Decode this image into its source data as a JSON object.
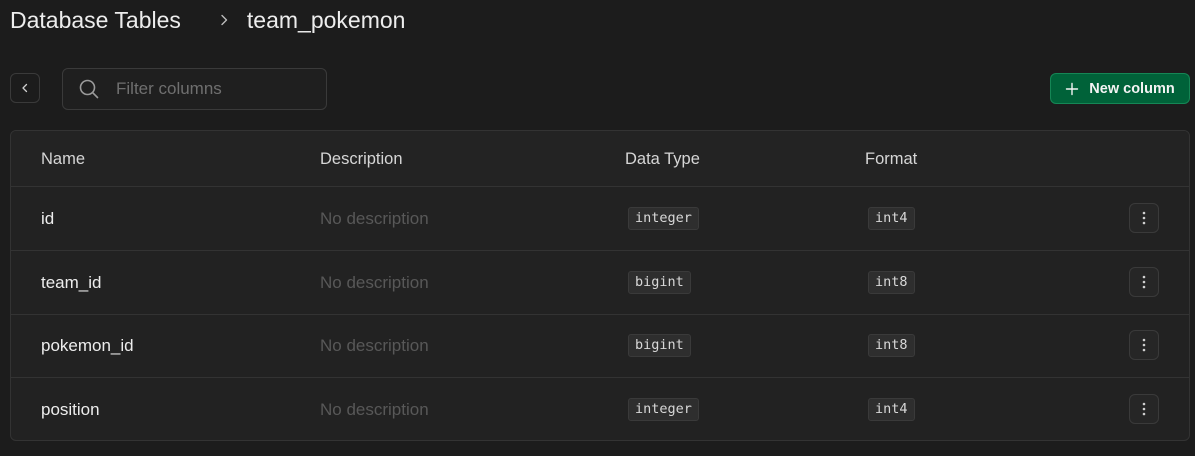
{
  "breadcrumb": {
    "root": "Database Tables",
    "current": "team_pokemon",
    "separator_icon": "chevron-right-icon"
  },
  "toolbar": {
    "back_icon": "chevron-left-icon",
    "filter": {
      "placeholder": "Filter columns",
      "value": "",
      "icon": "search-icon"
    },
    "new_column_label": "New column",
    "new_column_icon": "plus-icon"
  },
  "table": {
    "headers": {
      "name": "Name",
      "description": "Description",
      "data_type": "Data Type",
      "format": "Format"
    },
    "rows": [
      {
        "name": "id",
        "description": "No description",
        "data_type": "integer",
        "format": "int4"
      },
      {
        "name": "team_id",
        "description": "No description",
        "data_type": "bigint",
        "format": "int8"
      },
      {
        "name": "pokemon_id",
        "description": "No description",
        "data_type": "bigint",
        "format": "int8"
      },
      {
        "name": "position",
        "description": "No description",
        "data_type": "integer",
        "format": "int4"
      }
    ],
    "row_menu_icon": "more-vertical-icon"
  },
  "colors": {
    "background": "#1c1c1c",
    "surface": "#222222",
    "border": "#333333",
    "accent": "#006239",
    "text": "#ededed",
    "muted_text": "#585858"
  }
}
